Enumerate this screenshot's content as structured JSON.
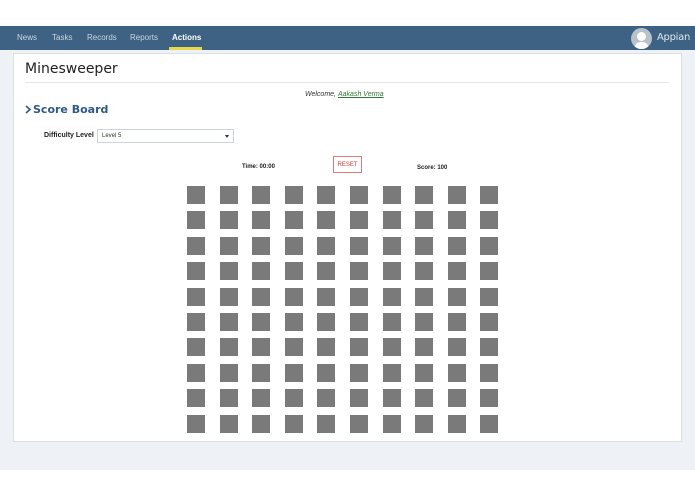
{
  "nav": {
    "items": [
      {
        "label": "News"
      },
      {
        "label": "Tasks"
      },
      {
        "label": "Records"
      },
      {
        "label": "Reports"
      },
      {
        "label": "Actions"
      }
    ],
    "active_label": "Actions",
    "brand": "Appian"
  },
  "page": {
    "title": "Minesweeper",
    "welcome_label": "Welcome,",
    "user_name": "Aakash Verma",
    "score_board_label": "Score Board"
  },
  "controls": {
    "difficulty_label": "Difficulty Level",
    "difficulty_value": "Level 5",
    "time_label": "Time: 00:00",
    "reset_label": "RESET",
    "score_label": "Score: 100"
  },
  "board": {
    "rows": 10,
    "cols": 10,
    "cell_state": "hidden"
  },
  "colors": {
    "topbar": "#3d6283",
    "active_underline": "#e6d84a",
    "cell": "#7a7a7a",
    "reset": "#cc3b3b",
    "link": "#2e7d32",
    "score_board": "#2e5a87"
  },
  "icons": {
    "avatar": "user-avatar-icon",
    "score_board_chevron": "chevron-right-icon",
    "dropdown": "chevron-down-icon"
  }
}
